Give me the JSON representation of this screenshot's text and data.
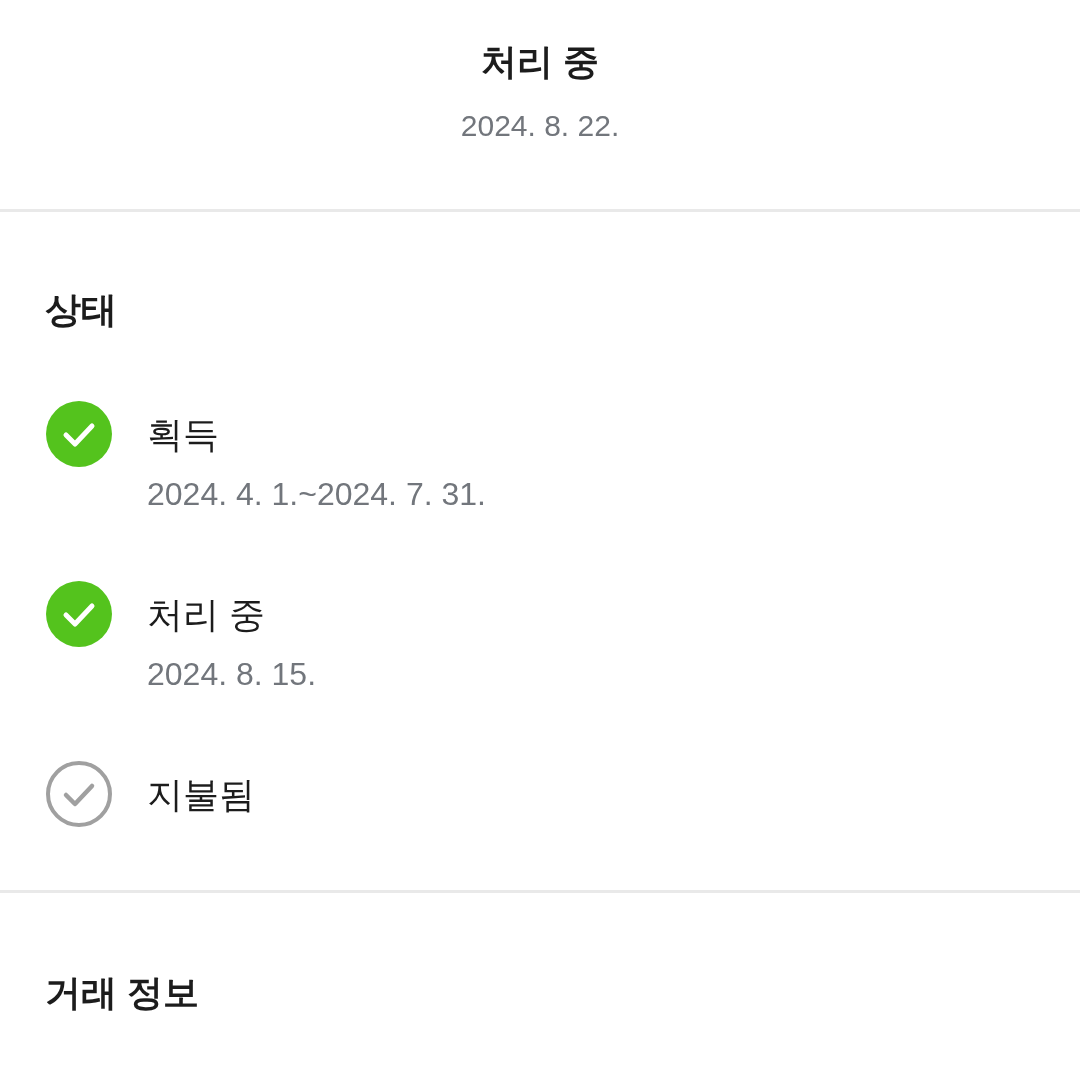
{
  "header": {
    "status": "처리 중",
    "date": "2024. 8. 22."
  },
  "status_section": {
    "title": "상태",
    "steps": [
      {
        "label": "획득",
        "date": "2024. 4. 1.~2024. 7. 31.",
        "done": true
      },
      {
        "label": "처리 중",
        "date": "2024. 8. 15.",
        "done": true
      },
      {
        "label": "지불됨",
        "done": false
      }
    ]
  },
  "transaction_section": {
    "title": "거래 정보"
  }
}
